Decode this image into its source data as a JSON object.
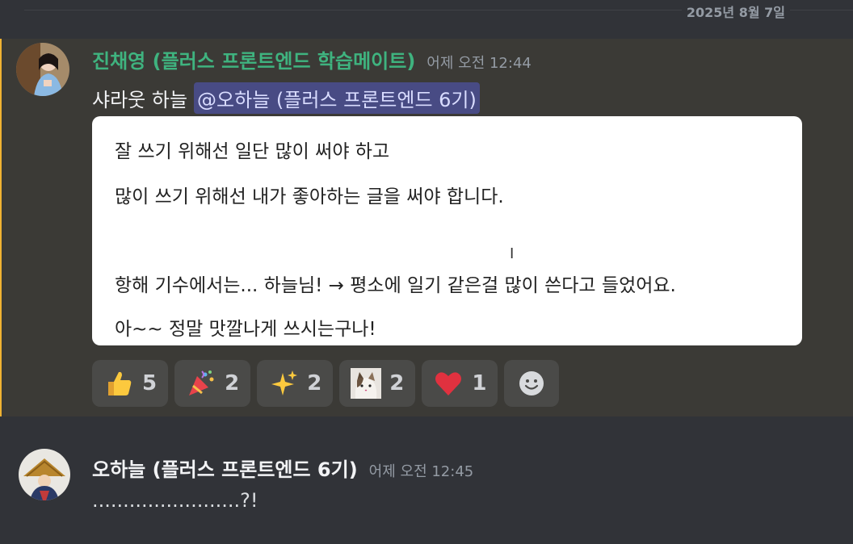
{
  "date_divider": "2025년 8월 7일",
  "messages": [
    {
      "username": "진채영 (플러스 프론트엔드 학습메이트)",
      "timestamp": "어제 오전 12:44",
      "text": "샤라웃 하늘",
      "mention": "@오하늘 (플러스 프론트엔드 6기)",
      "attachment_lines": [
        "잘 쓰기 위해선 일단 많이 써야 하고",
        "많이 쓰기 위해선 내가 좋아하는 글을 써야 합니다.",
        "항해 기수에서는... 하늘님! → 평소에 일기 같은걸 많이 쓴다고 들었어요.",
        "아~~ 정말 맛깔나게 쓰시는구나!"
      ],
      "reactions": [
        {
          "icon": "thumbs-up-icon",
          "count": "5"
        },
        {
          "icon": "party-popper-icon",
          "count": "2"
        },
        {
          "icon": "sparkles-icon",
          "count": "2"
        },
        {
          "icon": "cat-icon",
          "count": "2"
        },
        {
          "icon": "heart-icon",
          "count": "1"
        }
      ],
      "accent_color": "#f0b232",
      "name_color": "#3fb37f"
    },
    {
      "username": "오하늘 (플러스 프론트엔드 6기)",
      "timestamp": "어제 오전 12:45",
      "text": "........................?!"
    }
  ]
}
